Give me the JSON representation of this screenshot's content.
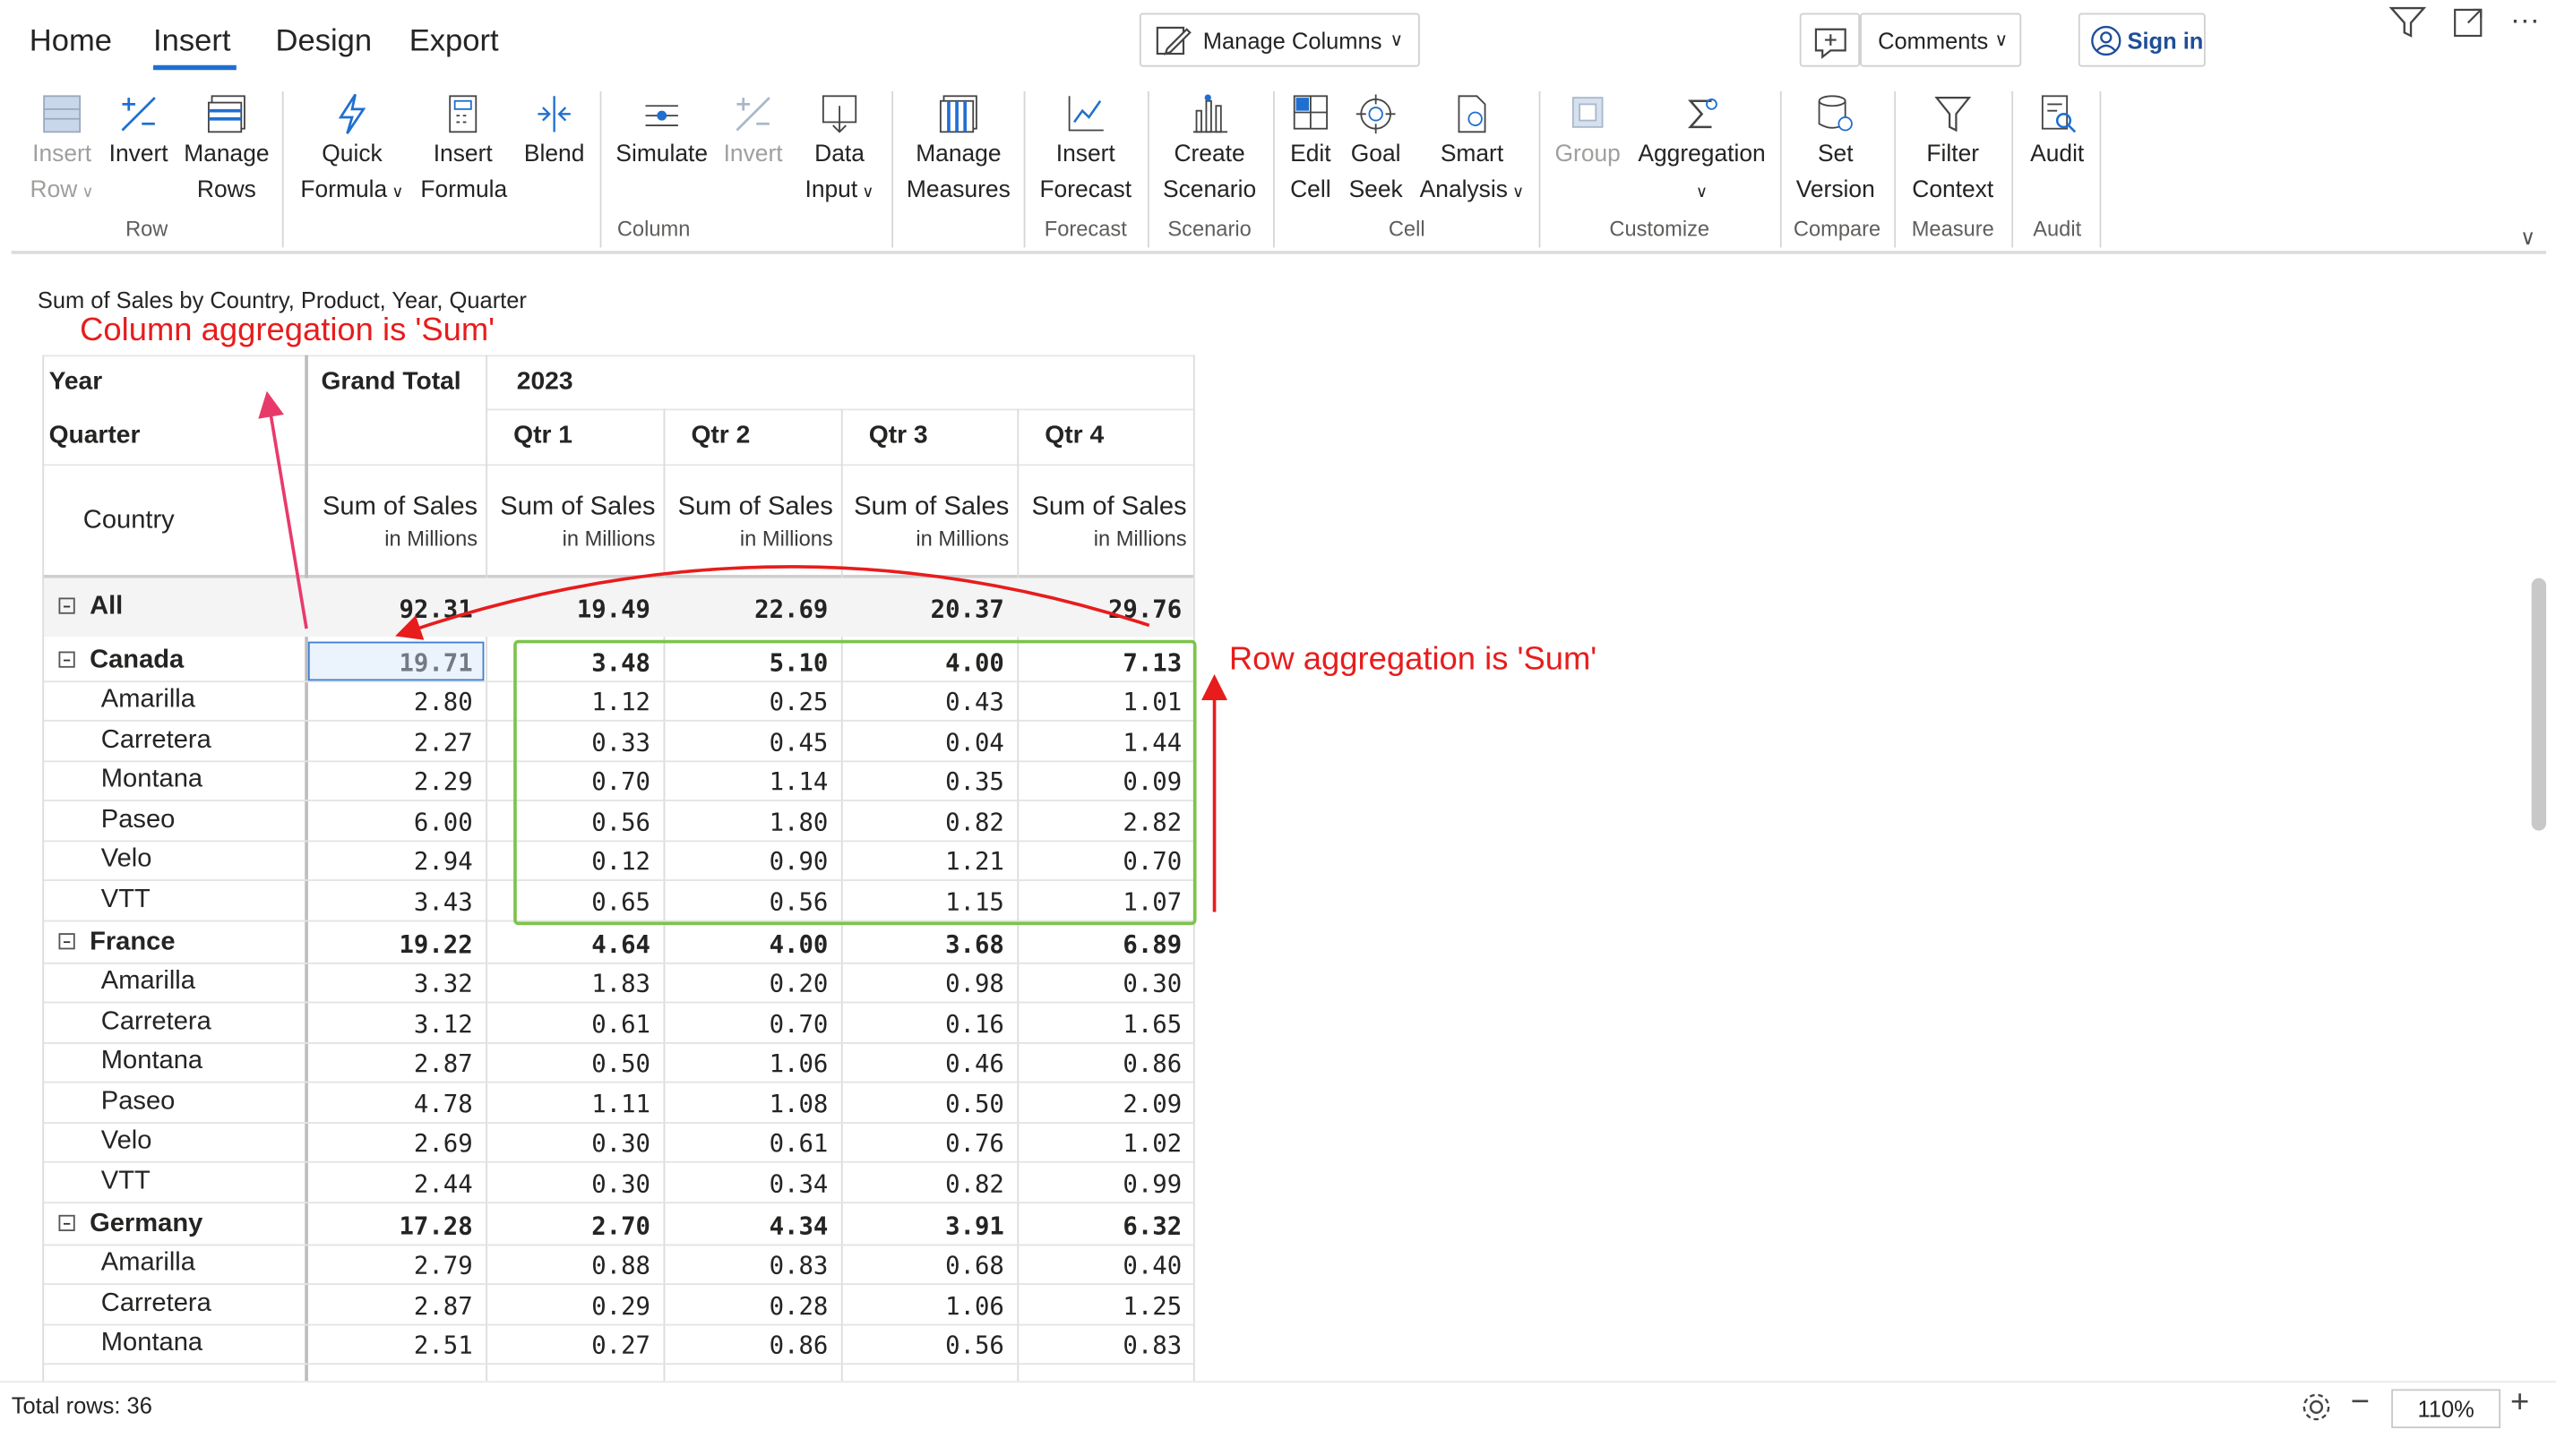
{
  "tabs": [
    {
      "label": "Home"
    },
    {
      "label": "Insert"
    },
    {
      "label": "Design"
    },
    {
      "label": "Export"
    }
  ],
  "toolbar": {
    "manage_columns": "Manage Columns",
    "comments": "Comments",
    "sign_in": "Sign in"
  },
  "ribbon": {
    "row": [
      {
        "l1": "Insert",
        "l2": "Row",
        "icon": "insert-row-icon"
      },
      {
        "l1": "Invert",
        "l2": "",
        "icon": "invert-icon"
      },
      {
        "l1": "Manage",
        "l2": "Rows",
        "icon": "manage-rows-icon"
      }
    ],
    "column": [
      {
        "l1": "Quick",
        "l2": "Formula",
        "icon": "quick-formula-icon"
      },
      {
        "l1": "Insert",
        "l2": "Formula",
        "icon": "insert-formula-icon"
      },
      {
        "l1": "Blend",
        "l2": "",
        "icon": "blend-icon"
      },
      {
        "l1": "Simulate",
        "l2": "",
        "icon": "simulate-icon"
      },
      {
        "l1": "Invert",
        "l2": "",
        "icon": "invert-icon"
      },
      {
        "l1": "Data",
        "l2": "Input",
        "icon": "data-input-icon"
      },
      {
        "l1": "Manage",
        "l2": "Measures",
        "icon": "manage-measures-icon"
      }
    ],
    "forecast": [
      {
        "l1": "Insert",
        "l2": "Forecast",
        "icon": "insert-forecast-icon"
      }
    ],
    "scenario": [
      {
        "l1": "Create",
        "l2": "Scenario",
        "icon": "create-scenario-icon"
      }
    ],
    "cell": [
      {
        "l1": "Edit",
        "l2": "Cell",
        "icon": "edit-cell-icon"
      },
      {
        "l1": "Goal",
        "l2": "Seek",
        "icon": "goal-seek-icon"
      },
      {
        "l1": "Smart",
        "l2": "Analysis",
        "icon": "smart-analysis-icon"
      }
    ],
    "customize": [
      {
        "l1": "Group",
        "l2": "",
        "icon": "group-icon"
      },
      {
        "l1": "Aggregation",
        "l2": "",
        "icon": "aggregation-icon"
      }
    ],
    "compare": [
      {
        "l1": "Set",
        "l2": "Version",
        "icon": "set-version-icon"
      }
    ],
    "measure": [
      {
        "l1": "Filter",
        "l2": "Context",
        "icon": "filter-context-icon"
      }
    ],
    "audit": [
      {
        "l1": "Audit",
        "l2": "",
        "icon": "audit-icon"
      }
    ],
    "groups": {
      "row": "Row",
      "column": "Column",
      "forecast": "Forecast",
      "scenario": "Scenario",
      "cell": "Cell",
      "customize": "Customize",
      "compare": "Compare",
      "measure": "Measure",
      "audit": "Audit"
    }
  },
  "report": {
    "title": "Sum of Sales by Country, Product, Year, Quarter",
    "annotation_column": "Column aggregation is 'Sum'",
    "annotation_row": "Row aggregation is 'Sum'",
    "header": {
      "year": "Year",
      "quarter": "Quarter",
      "country": "Country",
      "grand_total": "Grand Total",
      "year_value": "2023",
      "quarters": [
        "Qtr 1",
        "Qtr 2",
        "Qtr 3",
        "Qtr 4"
      ],
      "measure": "Sum of Sales",
      "unit": "in Millions"
    },
    "rows": [
      {
        "label": "All",
        "level": 0,
        "values": [
          "92.31",
          "19.49",
          "22.69",
          "20.37",
          "29.76"
        ]
      },
      {
        "label": "Canada",
        "level": 1,
        "values": [
          "19.71",
          "3.48",
          "5.10",
          "4.00",
          "7.13"
        ]
      },
      {
        "label": "Amarilla",
        "level": 2,
        "values": [
          "2.80",
          "1.12",
          "0.25",
          "0.43",
          "1.01"
        ]
      },
      {
        "label": "Carretera",
        "level": 2,
        "values": [
          "2.27",
          "0.33",
          "0.45",
          "0.04",
          "1.44"
        ]
      },
      {
        "label": "Montana",
        "level": 2,
        "values": [
          "2.29",
          "0.70",
          "1.14",
          "0.35",
          "0.09"
        ]
      },
      {
        "label": "Paseo",
        "level": 2,
        "values": [
          "6.00",
          "0.56",
          "1.80",
          "0.82",
          "2.82"
        ]
      },
      {
        "label": "Velo",
        "level": 2,
        "values": [
          "2.94",
          "0.12",
          "0.90",
          "1.21",
          "0.70"
        ]
      },
      {
        "label": "VTT",
        "level": 2,
        "values": [
          "3.43",
          "0.65",
          "0.56",
          "1.15",
          "1.07"
        ]
      },
      {
        "label": "France",
        "level": 1,
        "values": [
          "19.22",
          "4.64",
          "4.00",
          "3.68",
          "6.89"
        ]
      },
      {
        "label": "Amarilla",
        "level": 2,
        "values": [
          "3.32",
          "1.83",
          "0.20",
          "0.98",
          "0.30"
        ]
      },
      {
        "label": "Carretera",
        "level": 2,
        "values": [
          "3.12",
          "0.61",
          "0.70",
          "0.16",
          "1.65"
        ]
      },
      {
        "label": "Montana",
        "level": 2,
        "values": [
          "2.87",
          "0.50",
          "1.06",
          "0.46",
          "0.86"
        ]
      },
      {
        "label": "Paseo",
        "level": 2,
        "values": [
          "4.78",
          "1.11",
          "1.08",
          "0.50",
          "2.09"
        ]
      },
      {
        "label": "Velo",
        "level": 2,
        "values": [
          "2.69",
          "0.30",
          "0.61",
          "0.76",
          "1.02"
        ]
      },
      {
        "label": "VTT",
        "level": 2,
        "values": [
          "2.44",
          "0.30",
          "0.34",
          "0.82",
          "0.99"
        ]
      },
      {
        "label": "Germany",
        "level": 1,
        "values": [
          "17.28",
          "2.70",
          "4.34",
          "3.91",
          "6.32"
        ]
      },
      {
        "label": "Amarilla",
        "level": 2,
        "values": [
          "2.79",
          "0.88",
          "0.83",
          "0.68",
          "0.40"
        ]
      },
      {
        "label": "Carretera",
        "level": 2,
        "values": [
          "2.87",
          "0.29",
          "0.28",
          "1.06",
          "1.25"
        ]
      },
      {
        "label": "Montana",
        "level": 2,
        "values": [
          "2.51",
          "0.27",
          "0.86",
          "0.56",
          "0.83"
        ]
      }
    ]
  },
  "status": {
    "total_rows": "Total rows: 36",
    "zoom": "110%"
  },
  "colors": {
    "accent": "#1f6fd1",
    "annotation": "#e81c1c",
    "highlight": "#7cc44a"
  }
}
